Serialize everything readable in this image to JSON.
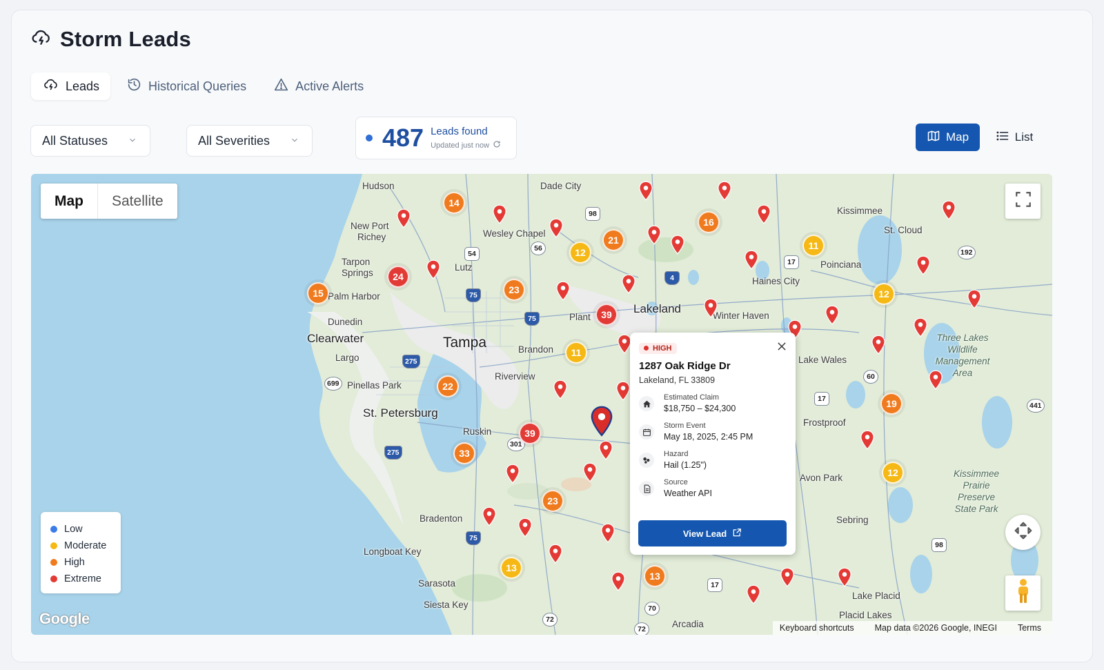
{
  "app": {
    "title": "Storm Leads"
  },
  "tabs": [
    {
      "label": "Leads",
      "active": true
    },
    {
      "label": "Historical Queries",
      "active": false
    },
    {
      "label": "Active Alerts",
      "active": false
    }
  ],
  "filters": {
    "status": "All Statuses",
    "severity": "All Severities"
  },
  "leads_summary": {
    "count": "487",
    "label": "Leads found",
    "updated": "Updated just now"
  },
  "view_toggle": {
    "map_label": "Map",
    "list_label": "List",
    "active": "Map"
  },
  "map": {
    "type_map": "Map",
    "type_satellite": "Satellite",
    "legend": [
      {
        "label": "Low",
        "color": "#3b7bea"
      },
      {
        "label": "Moderate",
        "color": "#f5b814"
      },
      {
        "label": "High",
        "color": "#f07a1e"
      },
      {
        "label": "Extreme",
        "color": "#e23b36"
      }
    ],
    "places": {
      "hudson": "Hudson",
      "dade_city": "Dade City",
      "kissimmee": "Kissimmee",
      "new_port_richey_1": "New Port",
      "new_port_richey_2": "Richey",
      "wesley_chapel": "Wesley Chapel",
      "st_cloud": "St. Cloud",
      "tarpon_1": "Tarpon",
      "tarpon_2": "Springs",
      "lutz": "Lutz",
      "poinciana": "Poinciana",
      "haines_city": "Haines City",
      "palm_harbor": "Palm Harbor",
      "lakeland": "Lakeland",
      "plant": "Plant",
      "winter_haven": "Winter Haven",
      "dunedin": "Dunedin",
      "clearwater": "Clearwater",
      "tampa": "Tampa",
      "brandon": "Brandon",
      "three_lakes_1": "Three Lakes",
      "three_lakes_2": "Wildlife",
      "three_lakes_3": "Management",
      "three_lakes_4": "Area",
      "largo": "Largo",
      "lake_wales": "Lake Wales",
      "pinellas_park": "Pinellas Park",
      "riverview": "Riverview",
      "st_petersburg": "St. Petersburg",
      "ruskin": "Ruskin",
      "frostproof": "Frostproof",
      "kpp_1": "Kissimmee",
      "kpp_2": "Prairie",
      "kpp_3": "Preserve",
      "kpp_4": "State Park",
      "avon_park": "Avon Park",
      "bradenton": "Bradenton",
      "sebring": "Sebring",
      "longboat_key": "Longboat Key",
      "sarasota": "Sarasota",
      "siesta_key": "Siesta Key",
      "lake_placid": "Lake Placid",
      "placid_lakes": "Placid Lakes",
      "arcadia": "Arcadia"
    },
    "shields": [
      "98",
      "54",
      "56",
      "75",
      "75",
      "4",
      "17",
      "192",
      "275",
      "699",
      "60",
      "17",
      "441",
      "301",
      "275",
      "75",
      "98",
      "17",
      "70",
      "72",
      "72"
    ],
    "clusters": [
      "14",
      "16",
      "21",
      "12",
      "11",
      "24",
      "15",
      "23",
      "39",
      "12",
      "11",
      "22",
      "19",
      "39",
      "33",
      "12",
      "23",
      "13",
      "13"
    ],
    "popup": {
      "severity": "HIGH",
      "address": "1287 Oak Ridge Dr",
      "city": "Lakeland, FL 33809",
      "claim_label": "Estimated Claim",
      "claim_value": "$18,750 – $24,300",
      "event_label": "Storm Event",
      "event_value": "May 18, 2025, 2:45 PM",
      "hazard_label": "Hazard",
      "hazard_value": "Hail (1.25\")",
      "source_label": "Source",
      "source_value": "Weather API",
      "button": "View Lead"
    },
    "attribution": {
      "logo": "Google",
      "shortcuts": "Keyboard shortcuts",
      "data": "Map data ©2026 Google, INEGI",
      "terms": "Terms"
    }
  }
}
